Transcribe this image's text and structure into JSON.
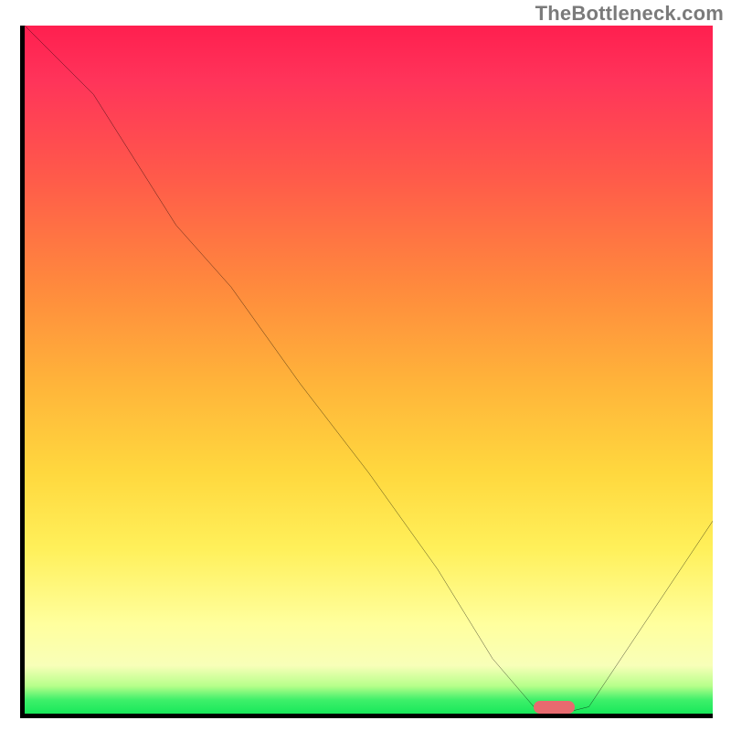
{
  "watermark": "TheBottleneck.com",
  "chart_data": {
    "type": "line",
    "title": "",
    "xlabel": "",
    "ylabel": "",
    "xlim": [
      0,
      100
    ],
    "ylim": [
      0,
      100
    ],
    "grid": false,
    "legend": false,
    "series": [
      {
        "name": "bottleneck-curve",
        "x": [
          0,
          10,
          22,
          30,
          40,
          50,
          60,
          68,
          74,
          78,
          82,
          100
        ],
        "y": [
          100,
          90,
          71,
          62,
          48,
          35,
          21,
          8,
          1,
          0,
          1,
          28
        ]
      }
    ],
    "marker": {
      "name": "optimal-range",
      "x_start": 74,
      "x_end": 80,
      "y": 0
    },
    "background_gradient": {
      "stops": [
        {
          "pos": 0,
          "color": "#ff1f4f"
        },
        {
          "pos": 22,
          "color": "#ff5a4a"
        },
        {
          "pos": 52,
          "color": "#ffb43a"
        },
        {
          "pos": 76,
          "color": "#fff05a"
        },
        {
          "pos": 93,
          "color": "#f8ffb8"
        },
        {
          "pos": 100,
          "color": "#18e85a"
        }
      ]
    }
  }
}
